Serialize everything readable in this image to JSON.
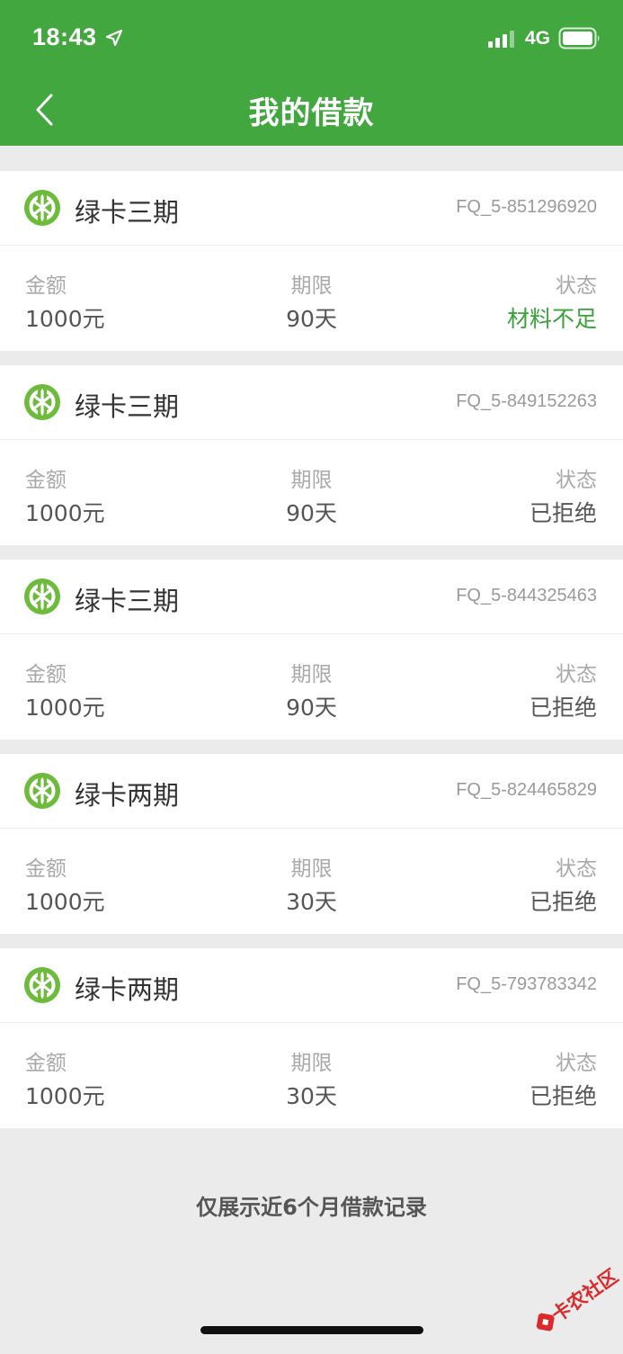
{
  "status_bar": {
    "time": "18:43",
    "network": "4G"
  },
  "header": {
    "title": "我的借款"
  },
  "loans": [
    {
      "product": "绿卡三期",
      "order_id": "FQ_5-851296920",
      "amount": "1000元",
      "term": "90天",
      "status": "材料不足"
    },
    {
      "product": "绿卡三期",
      "order_id": "FQ_5-849152263",
      "amount": "1000元",
      "term": "90天",
      "status": "已拒绝"
    },
    {
      "product": "绿卡三期",
      "order_id": "FQ_5-844325463",
      "amount": "1000元",
      "term": "90天",
      "status": "已拒绝"
    },
    {
      "product": "绿卡两期",
      "order_id": "FQ_5-824465829",
      "amount": "1000元",
      "term": "30天",
      "status": "已拒绝"
    },
    {
      "product": "绿卡两期",
      "order_id": "FQ_5-793783342",
      "amount": "1000元",
      "term": "30天",
      "status": "已拒绝"
    }
  ],
  "labels": {
    "amount": "金额",
    "term": "期限",
    "status": "状态"
  },
  "footer": {
    "note": "仅展示近6个月借款记录"
  },
  "watermark": {
    "text": "卡农社区"
  },
  "colors": {
    "brand_green": "#41a73e",
    "status_highlight": "#3aa13b",
    "background": "#ebebec"
  }
}
